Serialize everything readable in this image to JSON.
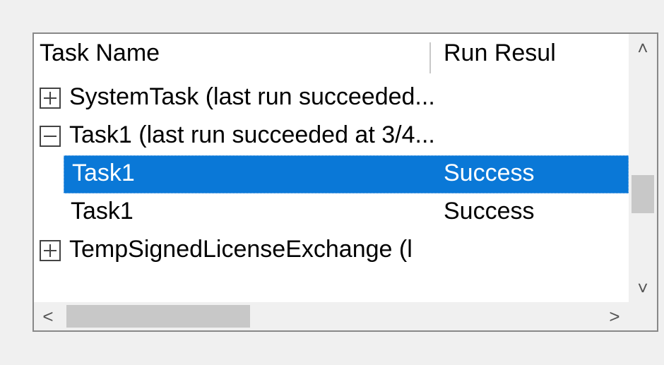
{
  "columns": {
    "task_name": "Task Name",
    "run_result": "Run Resul"
  },
  "rows": [
    {
      "type": "parent",
      "expanded": false,
      "label": "SystemTask (last run succeeded...",
      "result": ""
    },
    {
      "type": "parent",
      "expanded": true,
      "label": "Task1 (last run succeeded at 3/4...",
      "result": ""
    },
    {
      "type": "child",
      "selected": true,
      "label": "Task1",
      "result": "Success"
    },
    {
      "type": "child",
      "selected": false,
      "label": "Task1",
      "result": "Success"
    },
    {
      "type": "parent",
      "expanded": false,
      "label": "TempSignedLicenseExchange (l",
      "result": ""
    }
  ],
  "scroll": {
    "up": "˄",
    "down": "˅",
    "left": "<",
    "right": ">"
  }
}
